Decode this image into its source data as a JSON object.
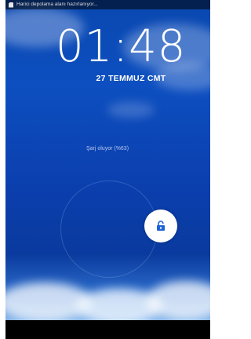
{
  "status_bar": {
    "notification_text": "Harici depolama alanı hazırlanıyor...",
    "icon": "sd-card-icon"
  },
  "lock_screen": {
    "time": "01:48",
    "date": "27 TEMMUZ CMT",
    "charging_text": "Şarj oluyor (%63)",
    "unlock_icon": "unlock-icon"
  },
  "colors": {
    "background_top": "#0a48b0",
    "background_bottom": "#7fb2e8",
    "handle": "#ffffff",
    "unlock_icon": "#1e63d6"
  }
}
